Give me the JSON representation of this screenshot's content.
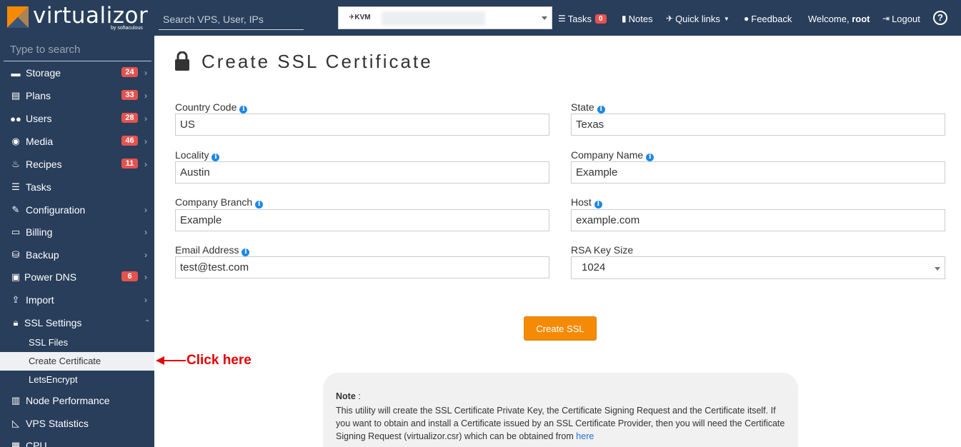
{
  "header": {
    "logo_text": "virtualizor",
    "logo_sub": "by softaculous",
    "search_placeholder": "Search VPS, User, IPs",
    "vps_select": {
      "prefix": "KVM"
    },
    "tasks_label": "Tasks",
    "tasks_count": "0",
    "notes_label": "Notes",
    "quick_links_label": "Quick links",
    "feedback_label": "Feedback",
    "welcome_prefix": "Welcome,",
    "welcome_user": "root",
    "logout_label": "Logout",
    "help_symbol": "?"
  },
  "sidebar": {
    "search_placeholder": "Type to search",
    "items": [
      {
        "label": "Storage",
        "badge": "24",
        "icon": "storage-icon"
      },
      {
        "label": "Plans",
        "badge": "33",
        "icon": "plans-icon"
      },
      {
        "label": "Users",
        "badge": "28",
        "icon": "users-icon"
      },
      {
        "label": "Media",
        "badge": "46",
        "icon": "media-icon"
      },
      {
        "label": "Recipes",
        "badge": "11",
        "icon": "recipes-icon"
      },
      {
        "label": "Tasks",
        "badge": "",
        "icon": "tasks-icon"
      },
      {
        "label": "Configuration",
        "badge": "",
        "icon": "wrench-icon"
      },
      {
        "label": "Billing",
        "badge": "",
        "icon": "billing-icon"
      },
      {
        "label": "Backup",
        "badge": "",
        "icon": "database-icon"
      },
      {
        "label": "Power DNS",
        "badge": "6",
        "icon": "dns-icon"
      },
      {
        "label": "Import",
        "badge": "",
        "icon": "import-icon"
      },
      {
        "label": "SSL Settings",
        "badge": "",
        "icon": "lock-icon"
      },
      {
        "label": "Node Performance",
        "badge": "",
        "icon": "performance-icon"
      },
      {
        "label": "VPS Statistics",
        "badge": "",
        "icon": "statistics-icon"
      },
      {
        "label": "CPU",
        "badge": "",
        "icon": "cpu-icon"
      }
    ],
    "ssl_sub_items": [
      {
        "label": "SSL Files"
      },
      {
        "label": "Create Certificate"
      },
      {
        "label": "LetsEncrypt"
      }
    ]
  },
  "main": {
    "title": "Create SSL Certificate",
    "fields": {
      "country_code": {
        "label": "Country Code",
        "value": "US"
      },
      "state": {
        "label": "State",
        "value": "Texas"
      },
      "locality": {
        "label": "Locality",
        "value": "Austin"
      },
      "company_name": {
        "label": "Company Name",
        "value": "Example"
      },
      "company_branch": {
        "label": "Company Branch",
        "value": "Example"
      },
      "host": {
        "label": "Host",
        "value": "example.com"
      },
      "email": {
        "label": "Email Address",
        "value": "test@test.com"
      },
      "rsa_key_size": {
        "label": "RSA Key Size",
        "value": "1024"
      }
    },
    "submit_label": "Create SSL",
    "annotation": "Click here",
    "note": {
      "title": "Note",
      "colon": ":",
      "text": "This utility will create the SSL Certificate Private Key, the Certificate Signing Request and the Certificate itself. If you want to obtain and install a Certificate issued by an SSL Certificate Provider, then you will need the Certificate Signing Request (virtualizor.csr) which can be obtained from",
      "link": "here"
    }
  },
  "colors": {
    "topbar": "#283e5b",
    "sidebar": "#283e5b",
    "badge": "#e4534e",
    "button": "#f58a06",
    "annotation": "#e60000",
    "link": "#1e6ed8"
  }
}
